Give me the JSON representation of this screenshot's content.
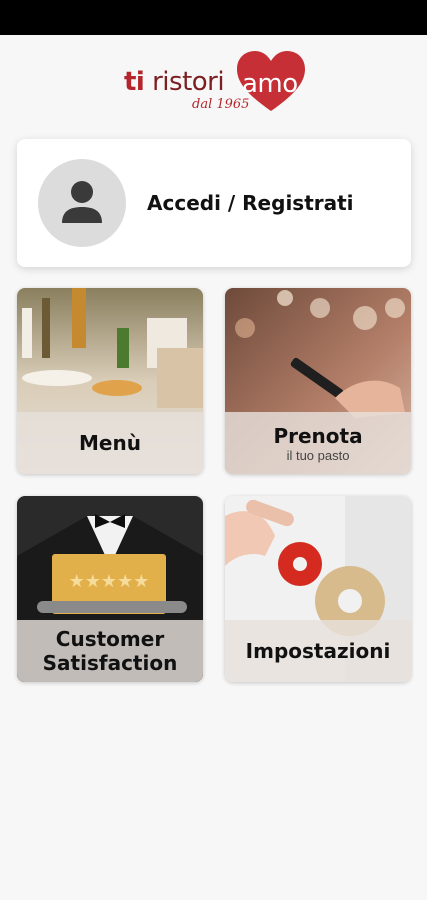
{
  "logo": {
    "prefix": "ti",
    "middle": "ristori",
    "heart_text": "amo",
    "since": "dal 1965",
    "brand_color": "#b3262c"
  },
  "login": {
    "label": "Accedi / Registrati",
    "icon": "user-icon"
  },
  "tiles": {
    "menu": {
      "title": "Menù"
    },
    "prenota": {
      "title": "Prenota",
      "subtitle": "il tuo pasto"
    },
    "customer": {
      "title_line1": "Customer",
      "title_line2": "Satisfaction"
    },
    "impostazioni": {
      "title": "Impostazioni"
    }
  }
}
